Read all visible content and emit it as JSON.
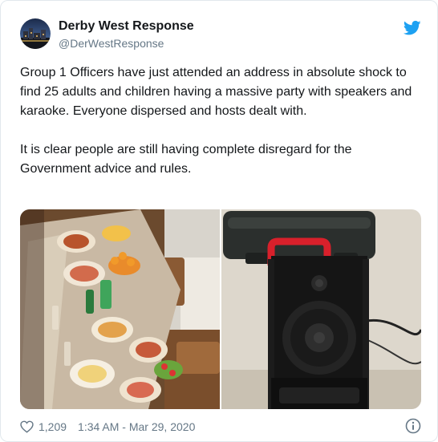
{
  "author": {
    "name": "Derby West Response",
    "handle": "@DerWestResponse",
    "avatar_icon": "avatar-city-night-photo"
  },
  "tweet": {
    "paragraphs": [
      "Group 1 Officers have just attended an address in absolute shock to find 25 adults and children having a massive party with speakers and karaoke. Everyone dispersed and hosts dealt with.",
      "It is clear people are still having complete disregard for the Government advice and rules."
    ]
  },
  "media": {
    "photos": [
      "party-food-table-photo",
      "speaker-and-karaoke-case-photo"
    ]
  },
  "footer": {
    "like_count": "1,209",
    "timestamp": "1:34 AM - Mar 29, 2020"
  },
  "icons": {
    "brand": "twitter-bird-icon",
    "like": "heart-icon",
    "info": "info-icon"
  },
  "colors": {
    "brand": "#1da1f2",
    "text": "#14171a",
    "secondary": "#657786",
    "border": "#e1e8ed"
  }
}
